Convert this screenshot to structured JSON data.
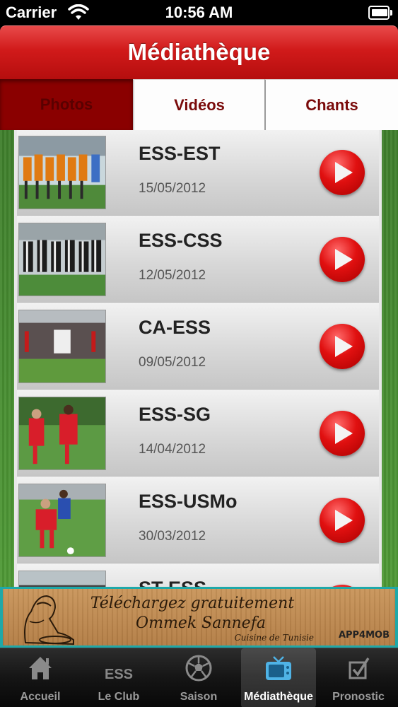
{
  "status_bar": {
    "carrier": "Carrier",
    "time": "10:56 AM"
  },
  "nav": {
    "title": "Médiathèque"
  },
  "tabs": [
    {
      "label": "Photos",
      "selected": true
    },
    {
      "label": "Vidéos",
      "selected": false
    },
    {
      "label": "Chants",
      "selected": false
    }
  ],
  "videos": [
    {
      "title": "ESS-EST",
      "date": "15/05/2012",
      "thumb": "team-photo-orange"
    },
    {
      "title": "ESS-CSS",
      "date": "12/05/2012",
      "thumb": "team-photo-stripes"
    },
    {
      "title": "CA-ESS",
      "date": "09/05/2012",
      "thumb": "stadium-crowd"
    },
    {
      "title": "ESS-SG",
      "date": "14/04/2012",
      "thumb": "players-red"
    },
    {
      "title": "ESS-USMo",
      "date": "30/03/2012",
      "thumb": "players-duel"
    },
    {
      "title": "ST-ESS",
      "date": "",
      "thumb": "partial-row"
    }
  ],
  "ad": {
    "line1": "Téléchargez gratuitement",
    "line2": "Ommek Sannefa",
    "line3": "Cuisine de Tunisie",
    "brand": "APP4MOB"
  },
  "tab_bar": [
    {
      "label": "Accueil",
      "icon": "home-icon",
      "active": false
    },
    {
      "label": "Le Club",
      "icon": "ess-icon",
      "icon_text": "ESS",
      "active": false
    },
    {
      "label": "Saison",
      "icon": "football-icon",
      "active": false
    },
    {
      "label": "Médiathèque",
      "icon": "tv-icon",
      "active": true
    },
    {
      "label": "Pronostic",
      "icon": "checkbox-icon",
      "active": false
    }
  ],
  "colors": {
    "nav_red": "#d11a1a",
    "tab_text": "#7a0a0a",
    "play_red": "#e01010",
    "grass": "#4f9a36",
    "tab_bar_bg": "#151515",
    "active_icon": "#4fb3e6"
  }
}
